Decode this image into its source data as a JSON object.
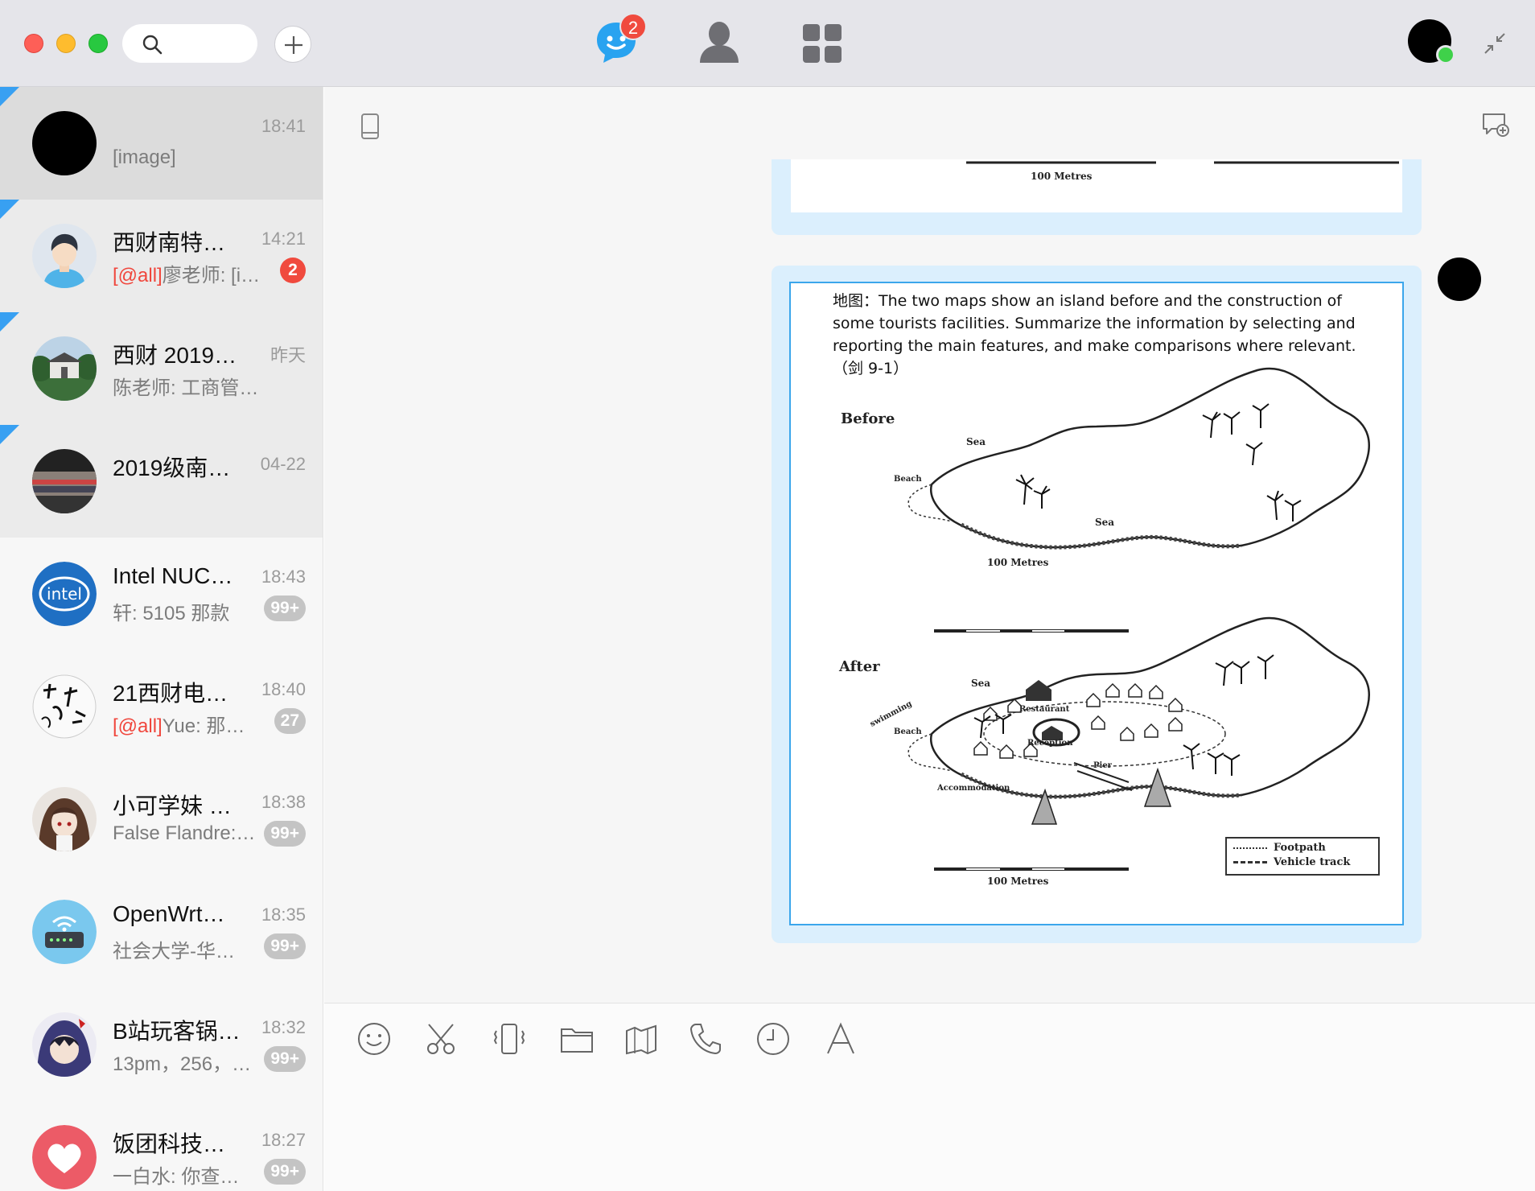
{
  "topbar": {
    "search_icon": "search-icon",
    "add_icon": "plus-icon",
    "nav": [
      {
        "name": "chat",
        "icon": "chat-bubble-icon",
        "badge": "2"
      },
      {
        "name": "contacts",
        "icon": "person-icon"
      },
      {
        "name": "apps",
        "icon": "grid-icon"
      }
    ],
    "collapse_icon": "collapse-arrows-icon"
  },
  "conversations": [
    {
      "title": "",
      "time": "18:41",
      "preview": "[image]",
      "pinned": true
    },
    {
      "title": "西财南特…",
      "time": "14:21",
      "at": "[@all]",
      "preview": "廖老师: [im…",
      "unread": "2",
      "pinned": true
    },
    {
      "title": "西财 2019…",
      "time": "昨天",
      "preview": "陈老师: 工商管…",
      "pinned": true
    },
    {
      "title": "2019级南…",
      "time": "04-22",
      "preview": "",
      "pinned": true
    },
    {
      "title": "Intel NUC…",
      "time": "18:43",
      "preview": "轩: 5105 那款",
      "unread": "99+"
    },
    {
      "title": "21西财电…",
      "time": "18:40",
      "at": "[@all]",
      "preview": "Yue: 那…",
      "unread": "27"
    },
    {
      "title": "小可学妹 …",
      "time": "18:38",
      "preview": "False Flandre:…",
      "unread": "99+"
    },
    {
      "title": "OpenWrt…",
      "time": "18:35",
      "preview": "社会大学-华…",
      "unread": "99+"
    },
    {
      "title": "B站玩客锅…",
      "time": "18:32",
      "preview": "13pm，256，…",
      "unread": "99+"
    },
    {
      "title": "饭团科技…",
      "time": "18:27",
      "preview": "一白水: 你查…",
      "unread": "99+"
    }
  ],
  "message": {
    "prompt": "地图：The two maps show an island before and the construction of some tourists facilities. Summarize the information by selecting and reporting the main features, and make comparisons where relevant. （剑 9-1）",
    "labels": {
      "before": "Before",
      "after": "After",
      "sea": "Sea",
      "beach": "Beach",
      "swimming": "swimming",
      "restaurant": "Restaurant",
      "reception": "Reception",
      "pier": "Pier",
      "accommodation": "Accommodation",
      "scale": "100 Metres",
      "legend_footpath": "Footpath",
      "legend_vehicle": "Vehicle track"
    }
  },
  "toolbar": {
    "tools": [
      "emoji-icon",
      "scissors-icon",
      "shake-icon",
      "folder-icon",
      "image-icon",
      "phone-icon",
      "clock-icon",
      "font-icon"
    ]
  },
  "colors": {
    "accent": "#38a0f2",
    "badge_red": "#f04a3e",
    "bubble": "#dbeffd",
    "online": "#3fd14a"
  }
}
